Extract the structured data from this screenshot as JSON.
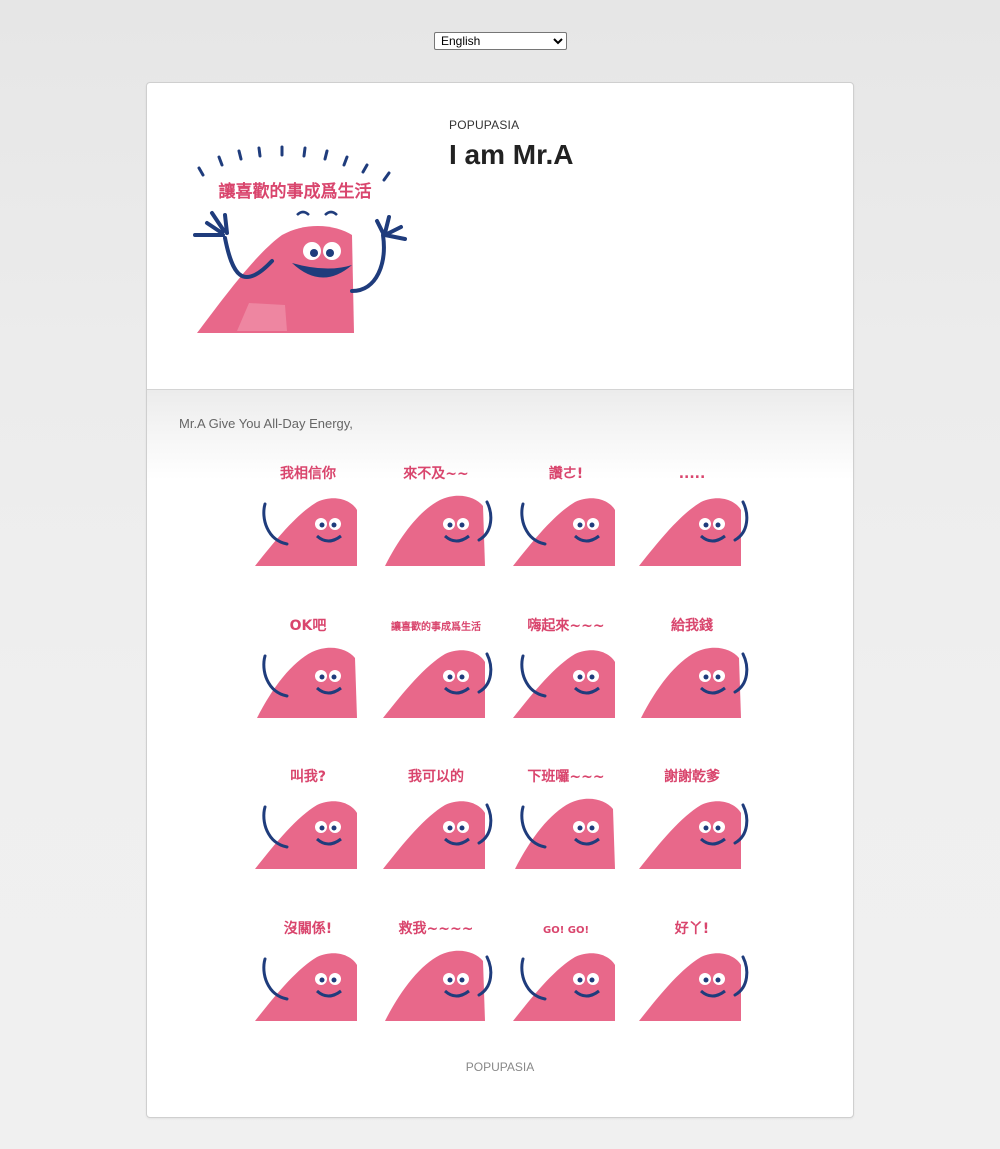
{
  "language_select": {
    "selected": "English"
  },
  "header": {
    "publisher": "POPUPASIA",
    "title": "I am Mr.A",
    "main_sticker_caption": "讓喜歡的事成爲生活"
  },
  "description": "Mr.A Give You All-Day Energy,",
  "stickers": [
    {
      "caption": "我相信你"
    },
    {
      "caption": "來不及~~"
    },
    {
      "caption": "讚ㄜ!"
    },
    {
      "caption": "....."
    },
    {
      "caption": "OK吧"
    },
    {
      "caption": "讓喜歡的事成爲生活"
    },
    {
      "caption": "嗨起來~~~"
    },
    {
      "caption": "給我錢"
    },
    {
      "caption": "叫我?"
    },
    {
      "caption": "我可以的"
    },
    {
      "caption": "下班囉~~~"
    },
    {
      "caption": "謝謝乾爹"
    },
    {
      "caption": "沒關係!"
    },
    {
      "caption": "救我~~~~"
    },
    {
      "caption": "GO! GO!"
    },
    {
      "caption": "好丫!"
    }
  ],
  "footer": {
    "publisher": "POPUPASIA"
  },
  "colors": {
    "sticker_pink": "#e8688a",
    "sticker_navy": "#1f3c7c",
    "caption_pink": "#d9456d"
  }
}
